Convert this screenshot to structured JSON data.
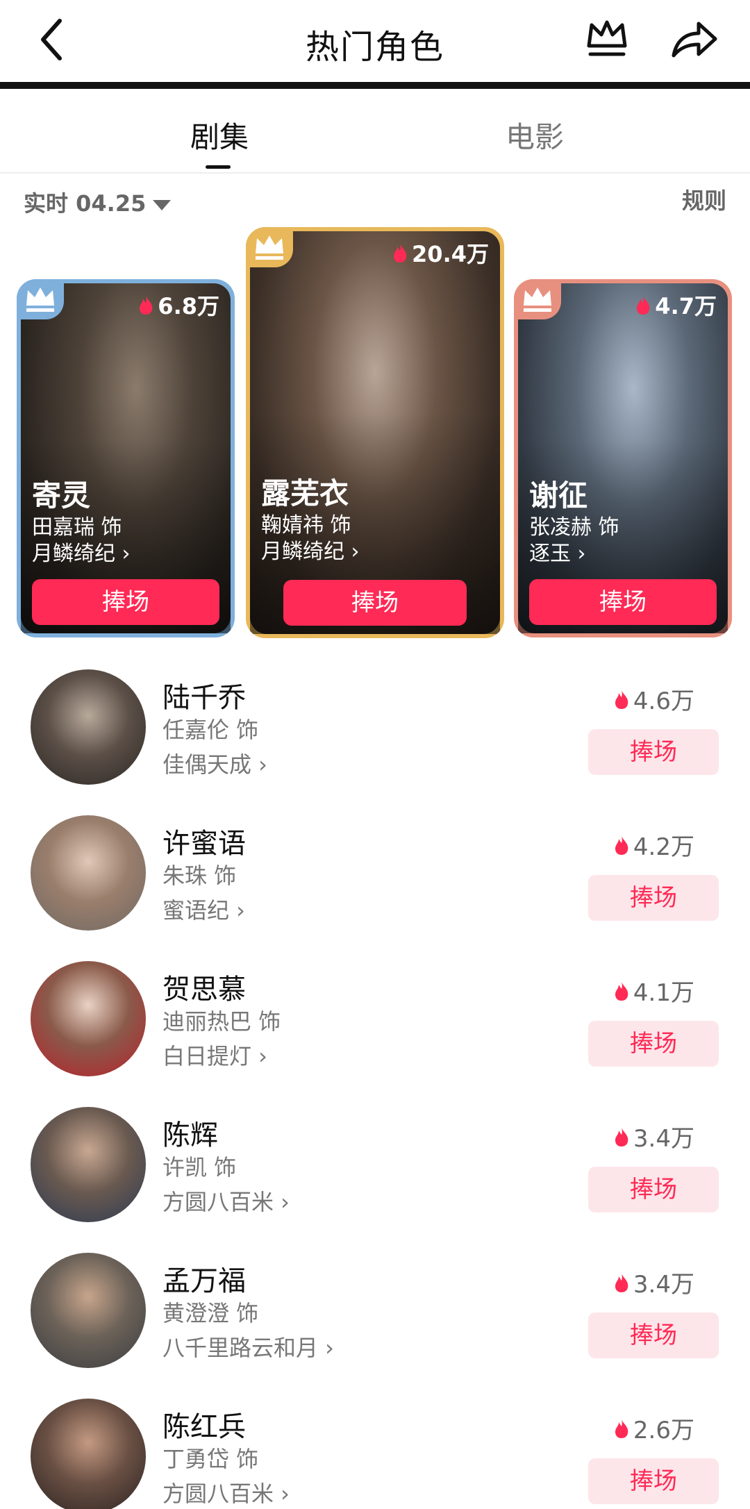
{
  "header": {
    "title": "热门角色",
    "back_icon": "back-arrow-icon",
    "crown_icon": "crown-icon",
    "share_icon": "share-arrow-icon"
  },
  "tabs": [
    {
      "label": "剧集",
      "active": true
    },
    {
      "label": "电影",
      "active": false
    }
  ],
  "filter": {
    "label": "实时 04.25",
    "rules_label": "规则"
  },
  "colors": {
    "accent": "#ff2a55",
    "button_light": "#fde6ea",
    "gold": "#e8b85a",
    "silver_blue": "#7fb0dc",
    "bronze": "#e8907f"
  },
  "podium": [
    {
      "rank_style": "silver",
      "heat": "6.8万",
      "name": "寄灵",
      "actor": "田嘉瑞 饰",
      "show": "月鳞绮纪 ›",
      "button": "捧场"
    },
    {
      "rank_style": "gold",
      "heat": "20.4万",
      "name": "露芜衣",
      "actor": "鞠婧祎 饰",
      "show": "月鳞绮纪 ›",
      "button": "捧场"
    },
    {
      "rank_style": "bronze",
      "heat": "4.7万",
      "name": "谢征",
      "actor": "张凌赫 饰",
      "show": "逐玉 ›",
      "button": "捧场"
    }
  ],
  "list": [
    {
      "name": "陆千乔",
      "actor": "任嘉伦 饰",
      "show": "佳偶天成 ›",
      "heat": "4.6万",
      "button": "捧场"
    },
    {
      "name": "许蜜语",
      "actor": "朱珠 饰",
      "show": "蜜语纪 ›",
      "heat": "4.2万",
      "button": "捧场"
    },
    {
      "name": "贺思慕",
      "actor": "迪丽热巴 饰",
      "show": "白日提灯 ›",
      "heat": "4.1万",
      "button": "捧场"
    },
    {
      "name": "陈辉",
      "actor": "许凯 饰",
      "show": "方圆八百米 ›",
      "heat": "3.4万",
      "button": "捧场"
    },
    {
      "name": "孟万福",
      "actor": "黄澄澄 饰",
      "show": "八千里路云和月 ›",
      "heat": "3.4万",
      "button": "捧场"
    },
    {
      "name": "陈红兵",
      "actor": "丁勇岱 饰",
      "show": "方圆八百米 ›",
      "heat": "2.6万",
      "button": "捧场"
    }
  ]
}
